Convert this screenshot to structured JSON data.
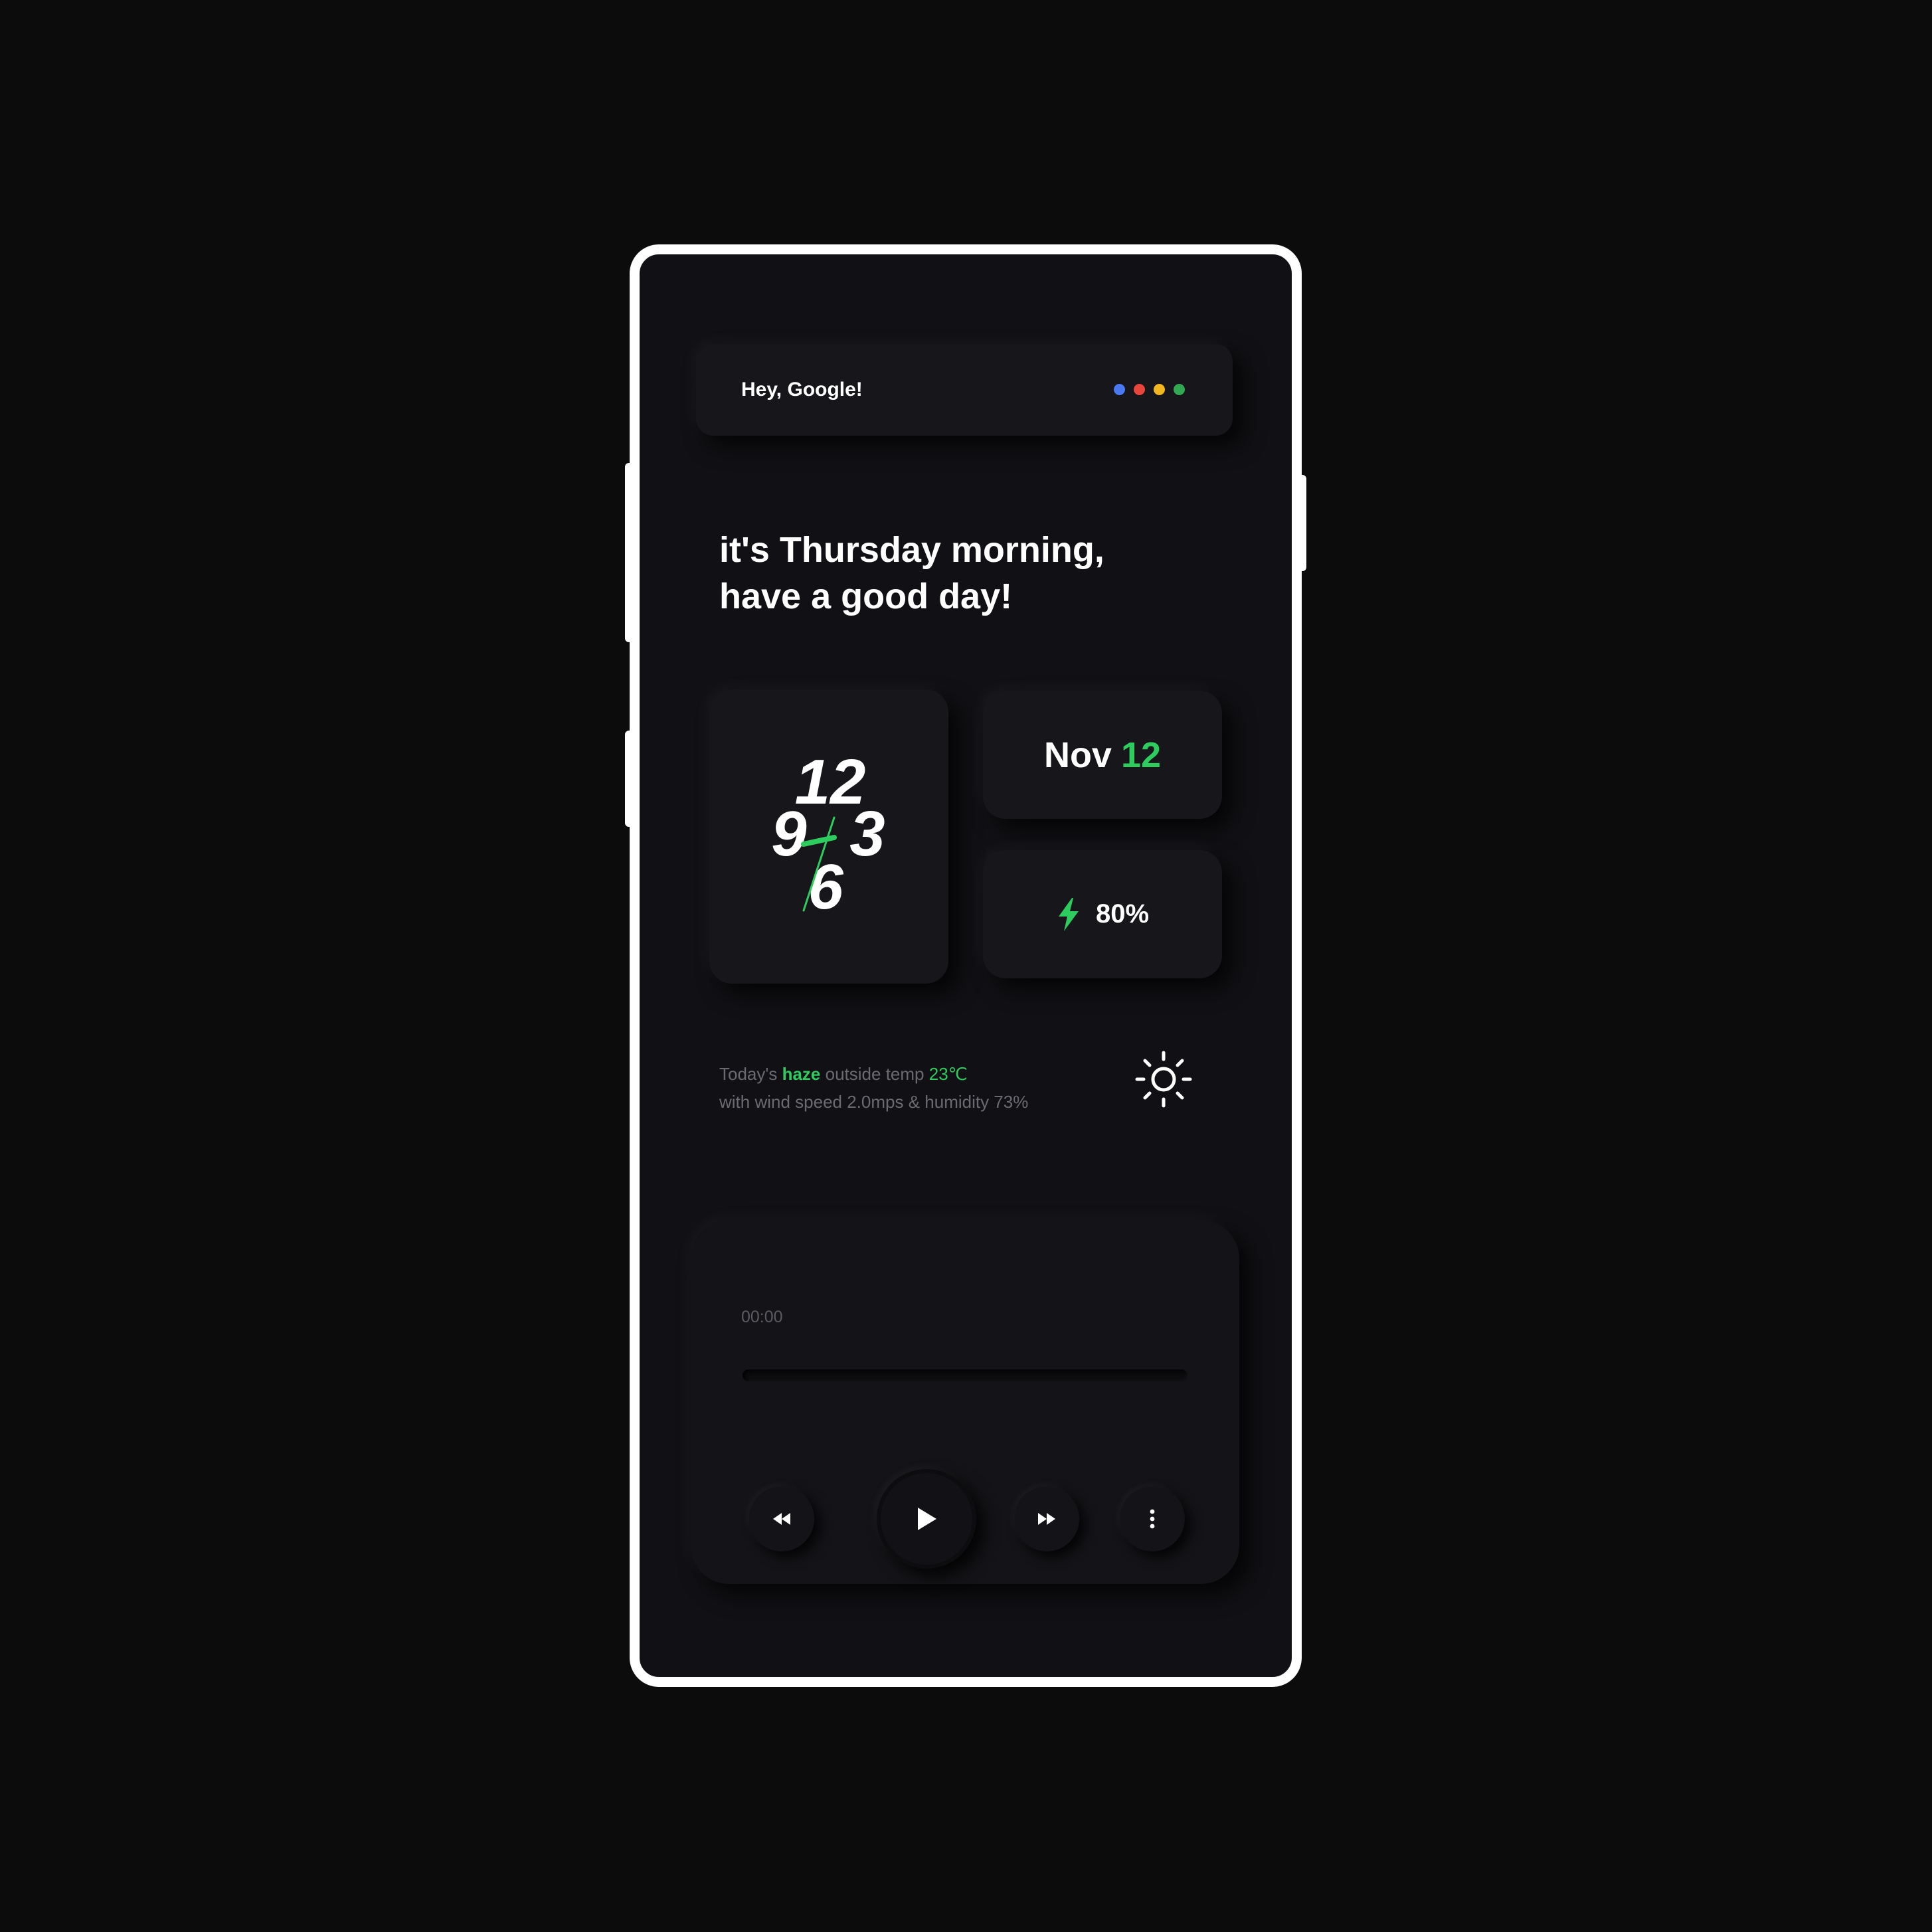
{
  "assistant": {
    "label": "Hey, Google!",
    "dot_colors": [
      "#4a78f0",
      "#e8453c",
      "#f2b621",
      "#32a852"
    ]
  },
  "greeting": {
    "line1": "it's Thursday morning,",
    "line2": "have a good day!"
  },
  "clock": {
    "numerals": [
      "12",
      "3",
      "6",
      "9"
    ],
    "hand_color": "#2ecc5e"
  },
  "date": {
    "month": "Nov",
    "day": "12"
  },
  "battery": {
    "icon": "lightning-bolt-icon",
    "level": "80%"
  },
  "weather": {
    "prefix": "Today's",
    "condition": "haze",
    "middle": "outside temp",
    "temperature": "23℃",
    "line2": "with wind speed 2.0mps & humidity 73%",
    "icon": "sun-icon"
  },
  "player": {
    "elapsed": "00:00",
    "progress_fraction": 0,
    "controls": [
      "rewind-icon",
      "play-icon",
      "fast-forward-icon",
      "more-vertical-icon"
    ]
  },
  "colors": {
    "accent": "#2ecc5e",
    "background": "#0c0c0c",
    "screen": "#111115",
    "card": "#17171b",
    "frame": "#ffffff"
  }
}
